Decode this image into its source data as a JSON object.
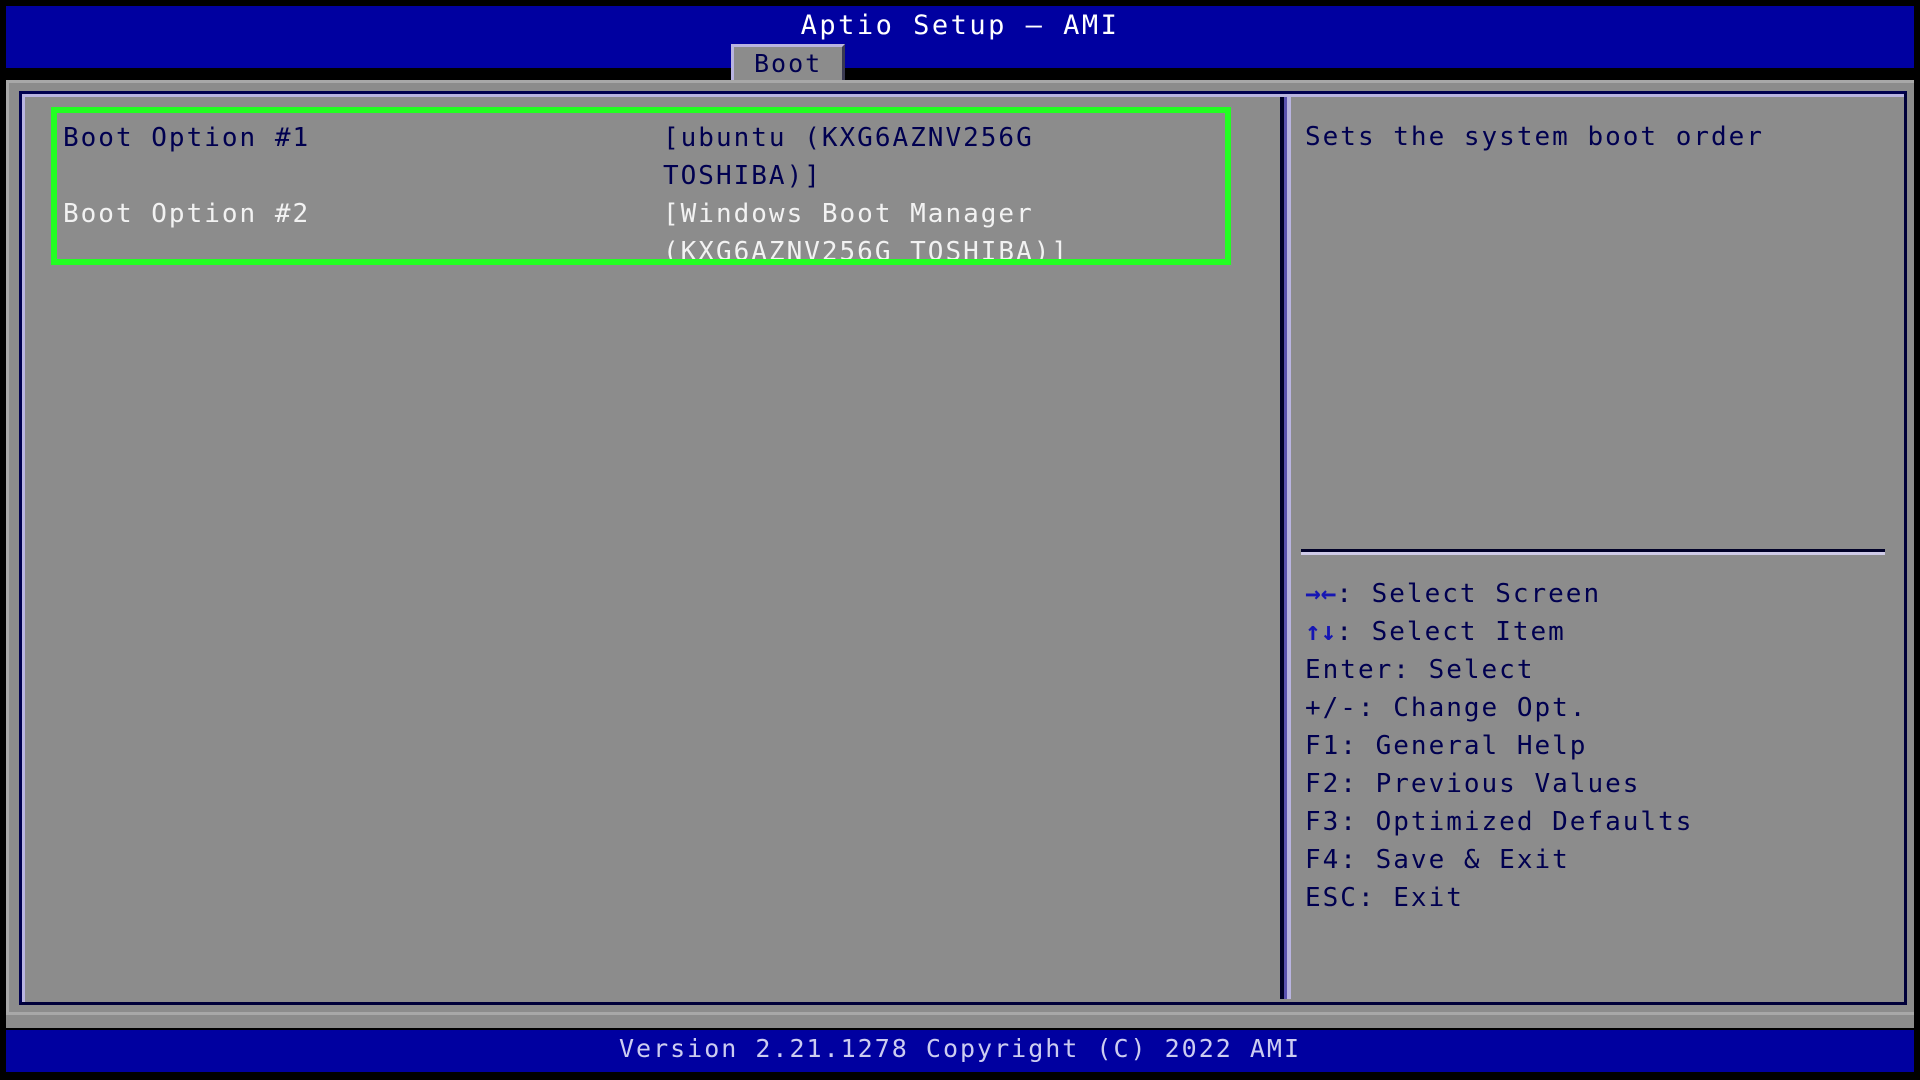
{
  "window": {
    "title": "Aptio Setup – AMI",
    "colors": {
      "header_blue": "#0000A0",
      "panel_gray": "#8C8C8C",
      "text_navy": "#000050",
      "text_white": "#F2F2F2",
      "annotation_green": "#22FF22",
      "footer_text": "#CCCCF0"
    }
  },
  "tabs": [
    {
      "label": "Boot",
      "active": true
    }
  ],
  "settings": {
    "rows": [
      {
        "label": "Boot Option #1",
        "value": "[ubuntu (KXG6AZNV256G TOSHIBA)]",
        "selected": true
      },
      {
        "label": "Boot Option #2",
        "value": "[Windows Boot Manager (KXG6AZNV256G TOSHIBA)]",
        "selected": false
      }
    ]
  },
  "help": {
    "description": "Sets the system boot order",
    "key_legend": [
      {
        "glyph": "→←",
        "text": ": Select Screen"
      },
      {
        "glyph": "↑↓",
        "text": ": Select Item"
      },
      {
        "glyph": "",
        "text": "Enter: Select"
      },
      {
        "glyph": "",
        "text": "+/-: Change Opt."
      },
      {
        "glyph": "",
        "text": "F1: General Help"
      },
      {
        "glyph": "",
        "text": "F2: Previous Values"
      },
      {
        "glyph": "",
        "text": "F3: Optimized Defaults"
      },
      {
        "glyph": "",
        "text": "F4: Save & Exit"
      },
      {
        "glyph": "",
        "text": "ESC: Exit"
      }
    ]
  },
  "footer": {
    "version_text": "Version 2.21.1278 Copyright (C) 2022 AMI"
  }
}
